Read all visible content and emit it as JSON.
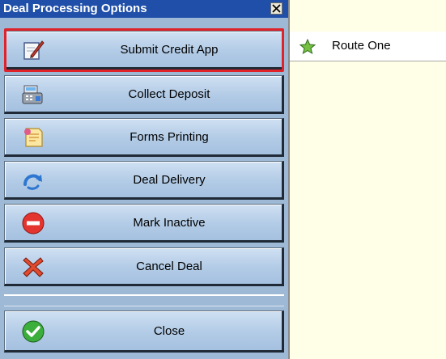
{
  "window": {
    "title": "Deal Processing Options"
  },
  "menu": {
    "buttons": [
      {
        "label": "Submit Credit App",
        "icon": "edit-document-icon"
      },
      {
        "label": "Collect Deposit",
        "icon": "cash-register-icon"
      },
      {
        "label": "Forms Printing",
        "icon": "forms-icon"
      },
      {
        "label": "Deal Delivery",
        "icon": "redo-arrow-icon"
      },
      {
        "label": "Mark Inactive",
        "icon": "no-entry-icon"
      },
      {
        "label": "Cancel Deal",
        "icon": "red-x-icon"
      }
    ],
    "close": {
      "label": "Close",
      "icon": "green-check-icon"
    }
  },
  "submenu": {
    "items": [
      {
        "label": "Route One",
        "icon": "green-star-icon"
      }
    ]
  },
  "colors": {
    "highlight": "#e0222a",
    "title_bar": "#1f4fa8",
    "panel": "#9db9d6",
    "submenu_bg": "#fffee6"
  }
}
